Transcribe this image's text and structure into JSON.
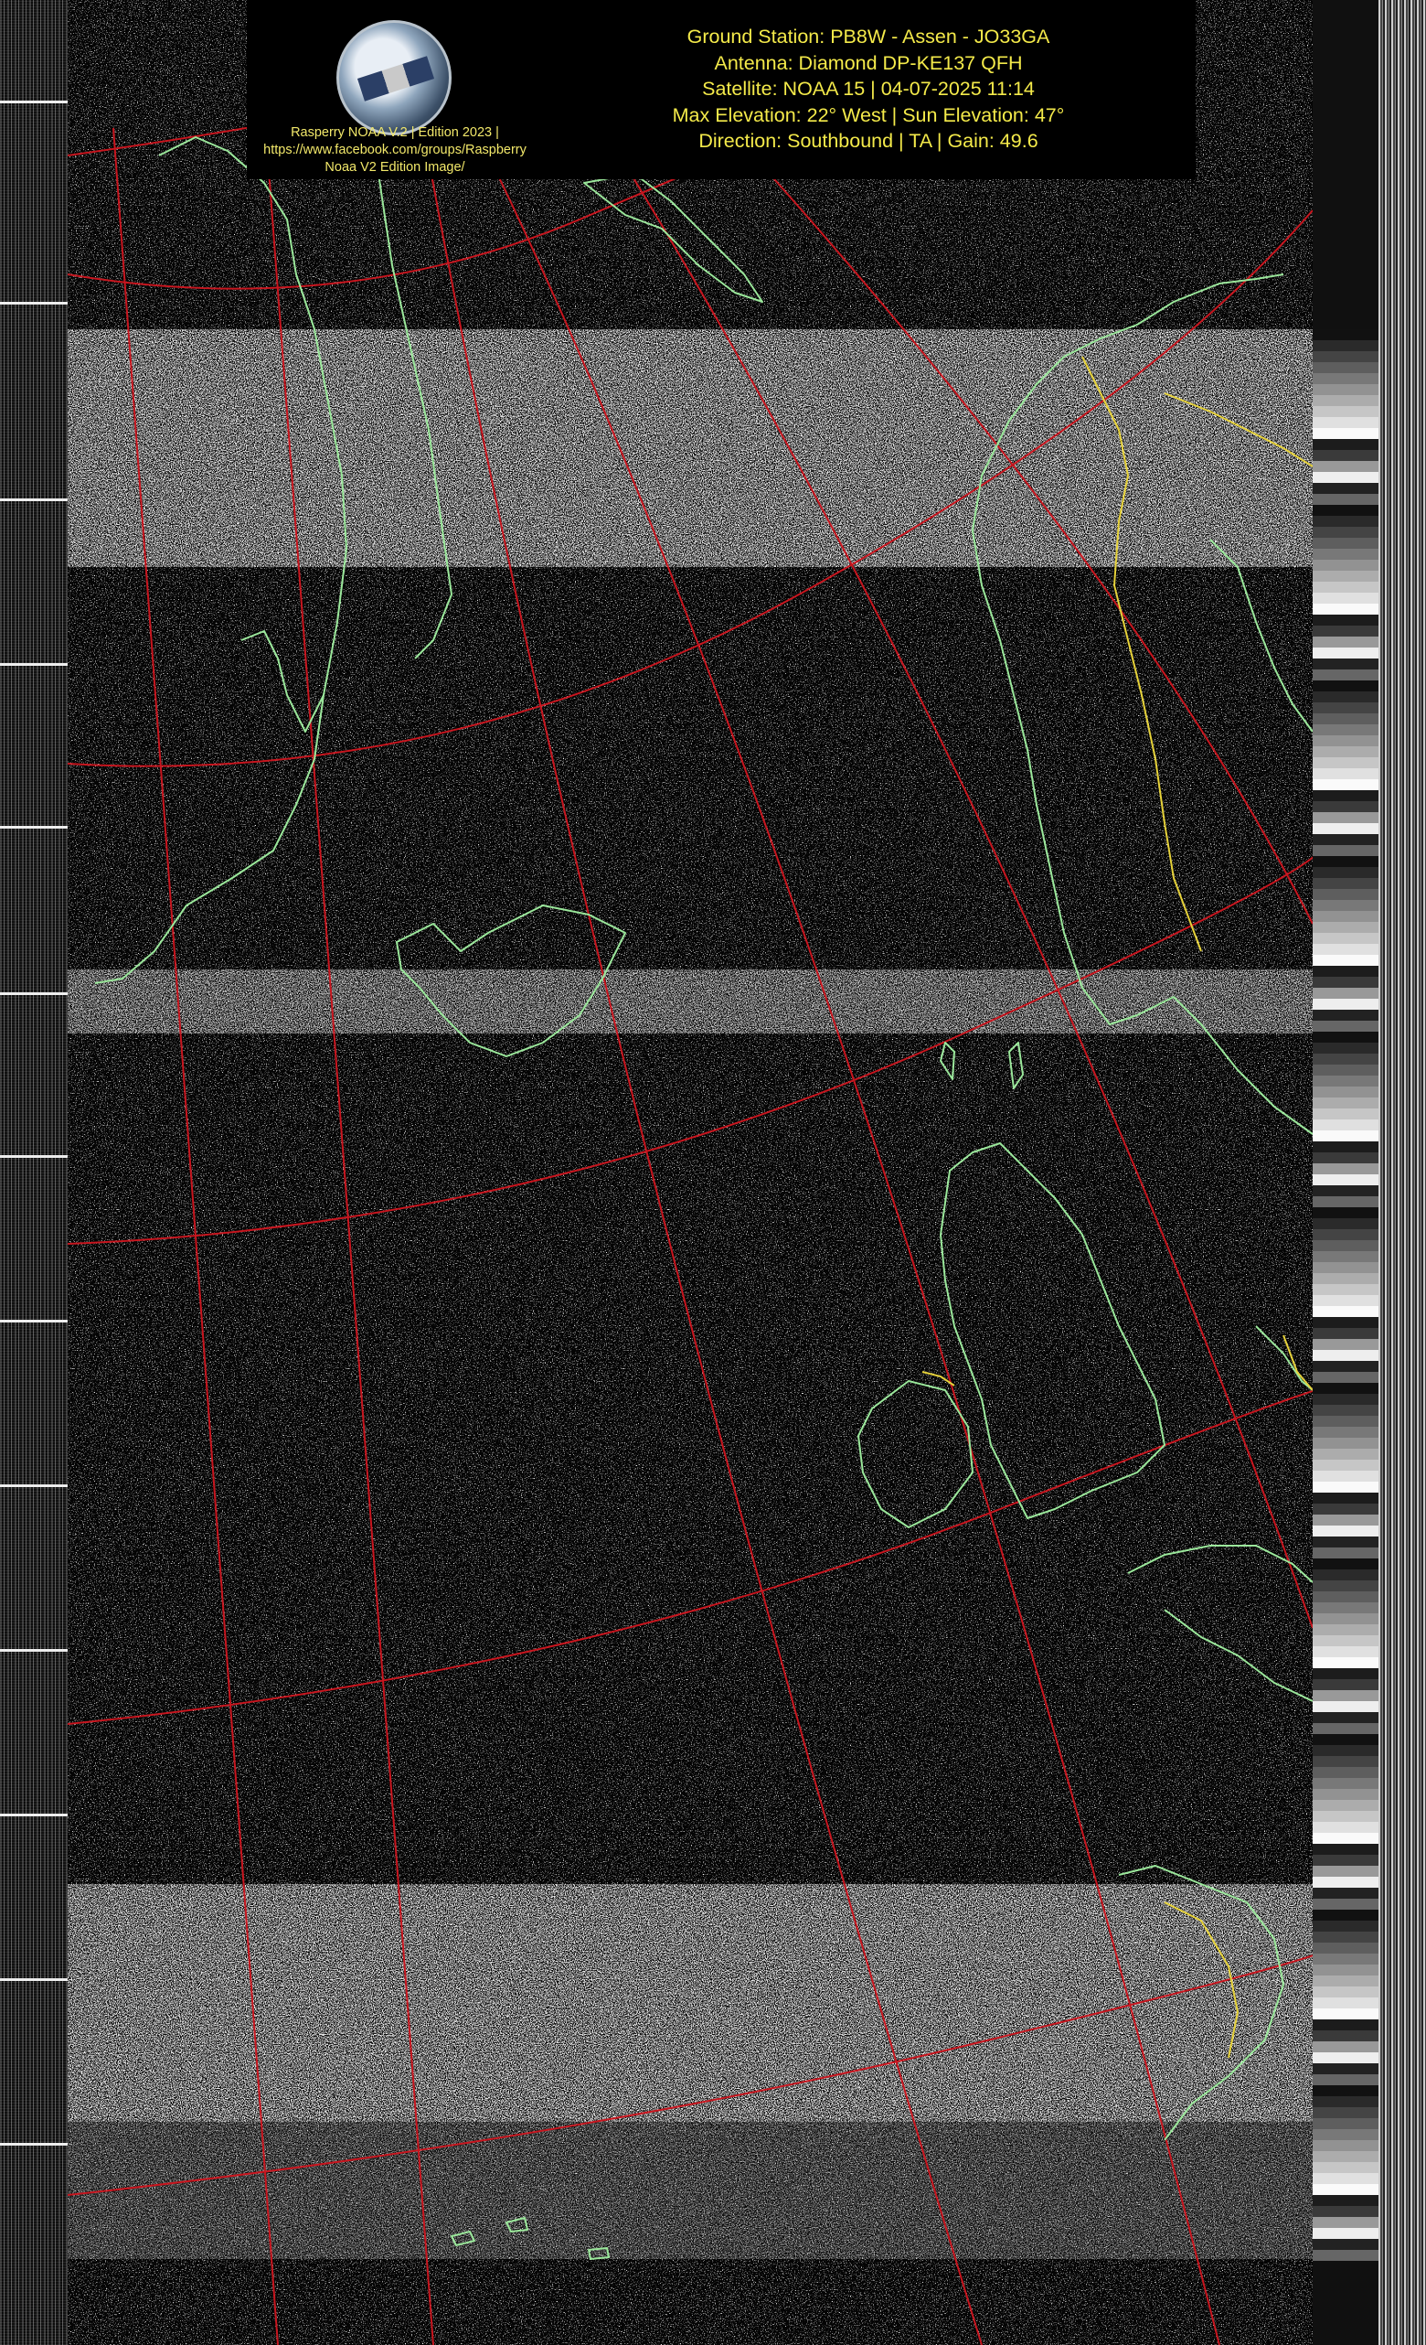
{
  "credit": {
    "line1": "Rasperry NOAA V.2 | Edition 2023 |",
    "line2": "https://www.facebook.com/groups/Raspberry",
    "line3": "Noaa V2 Edition Image/"
  },
  "station_info": {
    "ground_station": "Ground Station: PB8W - Assen - JO33GA",
    "antenna": "Antenna: Diamond DP-KE137 QFH",
    "satellite": "Satellite: NOAA 15 | 04-07-2025 11:14",
    "elevation": "Max Elevation: 22° West | Sun Elevation: 47°",
    "direction": "Direction: Southbound | TA | Gain: 49.6"
  },
  "colors": {
    "grid": "#c8161f",
    "coastline": "#9be89b",
    "border": "#e6d23a",
    "text": "#f4ea4a",
    "background": "#050505"
  }
}
